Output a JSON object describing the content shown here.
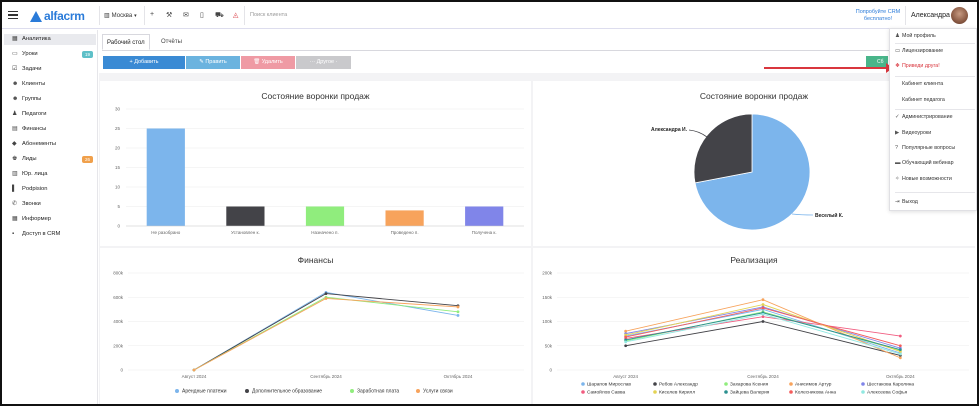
{
  "topbar": {
    "logo": "alfacrm",
    "city": "Москва",
    "search_placeholder": "Поиск клиента",
    "promo": "Попробуйте CRM бесплатно!",
    "user_name": "Александра"
  },
  "sidebar": {
    "items": [
      {
        "label": "Аналитика",
        "icon": "grid-icon",
        "active": true
      },
      {
        "label": "Уроки",
        "icon": "screen-icon",
        "badge": "19",
        "badge_color": "#5ec0c8"
      },
      {
        "label": "Задачи",
        "icon": "checklist-icon"
      },
      {
        "label": "Клиенты",
        "icon": "users-icon"
      },
      {
        "label": "Группы",
        "icon": "group-icon"
      },
      {
        "label": "Педагоги",
        "icon": "teacher-icon"
      },
      {
        "label": "Финансы",
        "icon": "money-icon"
      },
      {
        "label": "Абонементы",
        "icon": "tag-icon"
      },
      {
        "label": "Лиды",
        "icon": "user-plus-icon",
        "badge": "26",
        "badge_color": "#f0a04b"
      },
      {
        "label": "Юр. лица",
        "icon": "building-icon"
      },
      {
        "label": "Podpision",
        "icon": "doc-icon"
      },
      {
        "label": "Звонки",
        "icon": "phone-icon"
      },
      {
        "label": "Информер",
        "icon": "list-icon"
      },
      {
        "label": "Доступ в CRM",
        "icon": "lock-icon"
      }
    ]
  },
  "tabs": [
    "Рабочий стол",
    "Отчёты"
  ],
  "toolbar": {
    "add": "+ Добавить",
    "edit": "✎ Править",
    "delete": "🗑 Удалить",
    "other": "··· Другое ·",
    "green": "Сб"
  },
  "dropdown": {
    "items": [
      {
        "label": "Мой профиль",
        "icon": "user-icon"
      },
      {
        "label": "Лицензирование",
        "icon": "license-icon"
      },
      {
        "label": "Приведи друга!",
        "icon": "gift-icon",
        "highlight": true
      },
      {
        "label": "Кабинет клиента",
        "icon": ""
      },
      {
        "label": "Кабинет педагога",
        "icon": ""
      },
      {
        "label": "Администрирование",
        "icon": "check-icon"
      },
      {
        "label": "Видеоуроки",
        "icon": "video-icon"
      },
      {
        "label": "Популярные вопросы",
        "icon": "question-icon"
      },
      {
        "label": "Обучающий вебинар",
        "icon": "webinar-icon"
      },
      {
        "label": "Новые возможности",
        "icon": "star-icon"
      },
      {
        "label": "Выход",
        "icon": "exit-icon"
      }
    ]
  },
  "chart_data": [
    {
      "type": "bar",
      "title": "Состояние воронки продаж",
      "categories": [
        "Не разобрано",
        "Установлен к.",
        "Назначено п.",
        "Проведено п.",
        "Получена к."
      ],
      "values": [
        25,
        5,
        5,
        4,
        5
      ],
      "colors": [
        "#7cb5ec",
        "#434348",
        "#90ed7d",
        "#f7a35c",
        "#8085e9"
      ],
      "ylim": [
        0,
        30
      ],
      "yticks": [
        0,
        5,
        10,
        15,
        20,
        25,
        30
      ]
    },
    {
      "type": "pie",
      "title": "Состояние воронки продаж",
      "slices": [
        {
          "label": "Веселый К.",
          "value": 72,
          "color": "#7cb5ec"
        },
        {
          "label": "Александра И.",
          "value": 28,
          "color": "#434348"
        }
      ]
    },
    {
      "type": "line",
      "title": "Финансы",
      "categories": [
        "Август 2024",
        "Сентябрь 2024",
        "Октябрь 2024"
      ],
      "ylim": [
        0,
        800000
      ],
      "ytick_labels": [
        "0",
        "200k",
        "400k",
        "600k",
        "800k"
      ],
      "series": [
        {
          "name": "Арендные платежи",
          "color": "#7cb5ec",
          "values": [
            0,
            640000,
            450000
          ]
        },
        {
          "name": "Дополнительное образование",
          "color": "#434348",
          "values": [
            0,
            630000,
            530000
          ]
        },
        {
          "name": "Заработная плата",
          "color": "#90ed7d",
          "values": [
            0,
            600000,
            480000
          ]
        },
        {
          "name": "Услуги связи",
          "color": "#f7a35c",
          "values": [
            0,
            590000,
            520000
          ]
        }
      ]
    },
    {
      "type": "line",
      "title": "Реализация",
      "categories": [
        "Август 2024",
        "Сентябрь 2024",
        "Октябрь 2024"
      ],
      "ylim": [
        0,
        200000
      ],
      "ytick_labels": [
        "0",
        "50k",
        "100k",
        "150k",
        "200k"
      ],
      "series": [
        {
          "name": "Шарапов Мирослав",
          "color": "#7cb5ec",
          "values": [
            70000,
            125000,
            35000
          ]
        },
        {
          "name": "Ребов Александр",
          "color": "#434348",
          "values": [
            50000,
            100000,
            30000
          ]
        },
        {
          "name": "Захарова Ксения",
          "color": "#90ed7d",
          "values": [
            60000,
            120000,
            40000
          ]
        },
        {
          "name": "Анисимов Артур",
          "color": "#f7a35c",
          "values": [
            80000,
            145000,
            25000
          ]
        },
        {
          "name": "Шестакова Каролина",
          "color": "#8085e9",
          "values": [
            75000,
            130000,
            45000
          ]
        },
        {
          "name": "Самойлов Савва",
          "color": "#f15c80",
          "values": [
            65000,
            110000,
            70000
          ]
        },
        {
          "name": "Киселев Кирилл",
          "color": "#e4d354",
          "values": [
            72000,
            135000,
            38000
          ]
        },
        {
          "name": "Зайцева Валерия",
          "color": "#2b908f",
          "values": [
            62000,
            118000,
            42000
          ]
        },
        {
          "name": "Колесникова Анна",
          "color": "#f45b5b",
          "values": [
            68000,
            128000,
            50000
          ]
        },
        {
          "name": "Алексеева Софья",
          "color": "#91e8e1",
          "values": [
            58000,
            115000,
            33000
          ]
        }
      ]
    }
  ]
}
